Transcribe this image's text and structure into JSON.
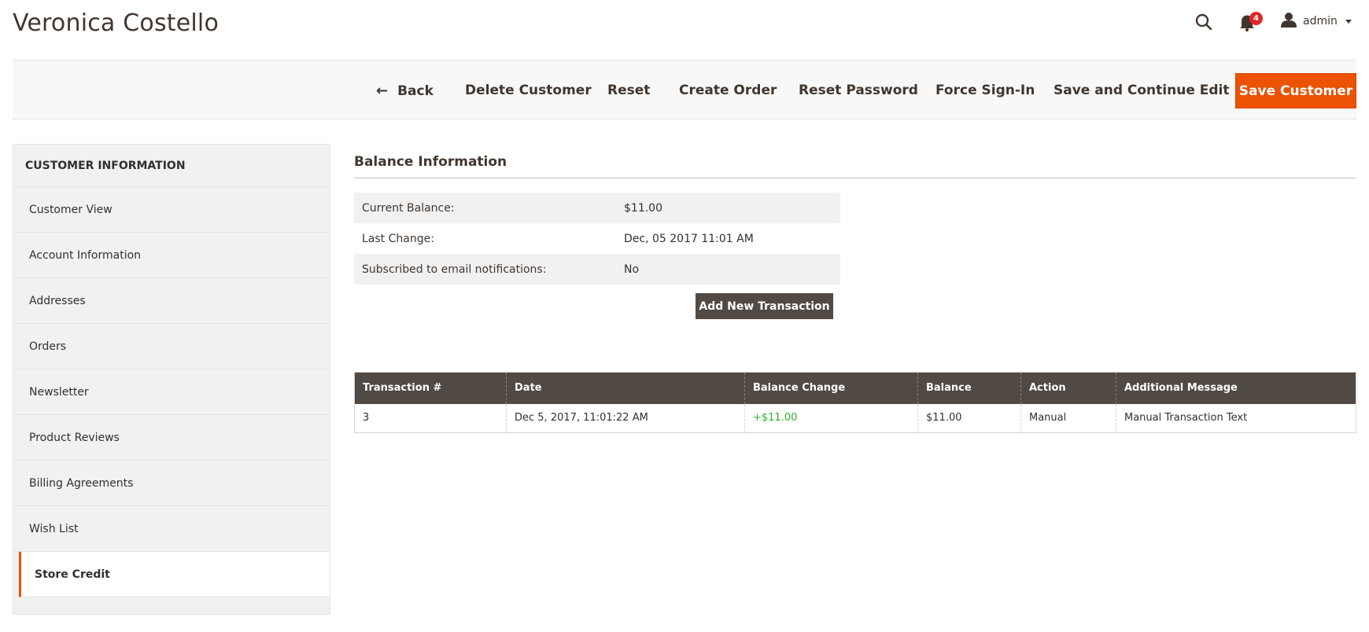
{
  "page": {
    "title": "Veronica Costello"
  },
  "header": {
    "search_icon": "search-icon",
    "notifications": {
      "icon": "bell-icon",
      "count": "4"
    },
    "user": {
      "icon": "user-icon",
      "label": "admin"
    }
  },
  "toolbar": {
    "back_label": "Back",
    "delete_label": "Delete Customer",
    "reset_label": "Reset",
    "create_order_label": "Create Order",
    "reset_password_label": "Reset Password",
    "force_signin_label": "Force Sign-In",
    "save_continue_label": "Save and Continue Edit",
    "save_label": "Save Customer"
  },
  "sidebar": {
    "heading": "CUSTOMER INFORMATION",
    "items": [
      {
        "label": "Customer View"
      },
      {
        "label": "Account Information"
      },
      {
        "label": "Addresses"
      },
      {
        "label": "Orders"
      },
      {
        "label": "Newsletter"
      },
      {
        "label": "Product Reviews"
      },
      {
        "label": "Billing Agreements"
      },
      {
        "label": "Wish List"
      },
      {
        "label": "Store Credit",
        "active": true
      }
    ]
  },
  "balance": {
    "title": "Balance Information",
    "rows": [
      {
        "label": "Current Balance:",
        "value": "$11.00"
      },
      {
        "label": "Last Change:",
        "value": "Dec, 05 2017 11:01 AM"
      },
      {
        "label": "Subscribed to email notifications:",
        "value": "No"
      }
    ],
    "add_button_label": "Add New Transaction"
  },
  "transactions": {
    "columns": [
      "Transaction #",
      "Date",
      "Balance Change",
      "Balance",
      "Action",
      "Additional Message"
    ],
    "rows": [
      [
        "3",
        "Dec 5, 2017, 11:01:22 AM",
        "+$11.00",
        "$11.00",
        "Manual",
        "Manual Transaction Text"
      ]
    ]
  },
  "colors": {
    "accent": "#eb5202",
    "dark": "#514943",
    "positive": "#2db22d",
    "badge": "#e22626"
  }
}
